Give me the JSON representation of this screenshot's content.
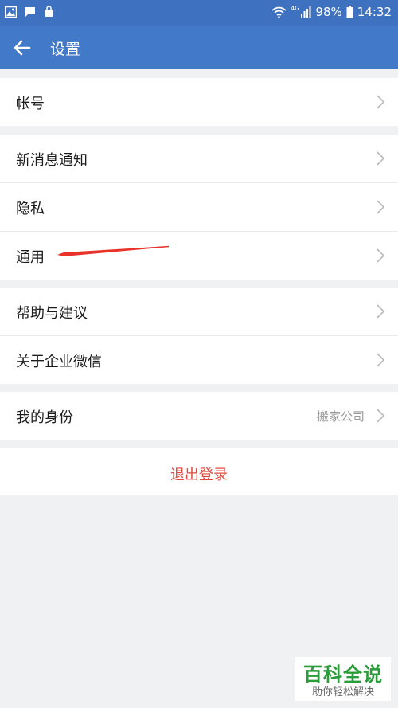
{
  "status_bar": {
    "battery_percent": "98%",
    "time": "14:32",
    "network": "4G"
  },
  "app_bar": {
    "title": "设置",
    "back_icon": "arrow-left-icon"
  },
  "groups": [
    {
      "items": [
        {
          "label": "帐号",
          "value": ""
        }
      ]
    },
    {
      "items": [
        {
          "label": "新消息通知",
          "value": ""
        },
        {
          "label": "隐私",
          "value": ""
        },
        {
          "label": "通用",
          "value": ""
        }
      ]
    },
    {
      "items": [
        {
          "label": "帮助与建议",
          "value": ""
        },
        {
          "label": "关于企业微信",
          "value": ""
        }
      ]
    },
    {
      "items": [
        {
          "label": "我的身份",
          "value": "搬家公司"
        }
      ]
    }
  ],
  "logout": {
    "label": "退出登录"
  },
  "colors": {
    "status_bar_bg": "#3e72c0",
    "app_bar_bg": "#4279c8",
    "logout_text": "#e04a3f",
    "annotation_arrow": "#e8322a"
  },
  "watermark": {
    "title": "百科全说",
    "subtitle": "助你轻松解决"
  }
}
